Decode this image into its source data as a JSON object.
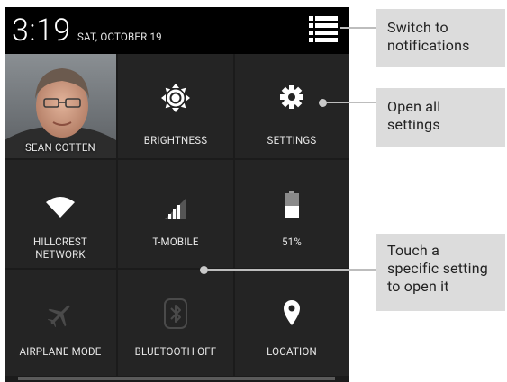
{
  "status_bar": {
    "time": "3:19",
    "date": "SAT, OCTOBER 19",
    "notifications_toggle_icon": "notifications-list-icon"
  },
  "quick_settings": {
    "tiles": [
      {
        "label": "SEAN COTTEN",
        "icon": "user-avatar-photo"
      },
      {
        "label": "BRIGHTNESS",
        "icon": "brightness-icon"
      },
      {
        "label": "SETTINGS",
        "icon": "gear-icon"
      },
      {
        "label": "HILLCREST\nNETWORK",
        "line1": "HILLCREST",
        "line2": "NETWORK",
        "icon": "wifi-icon"
      },
      {
        "label": "T-MOBILE",
        "icon": "cell-signal-icon"
      },
      {
        "label": "51%",
        "icon": "battery-icon",
        "battery_level": 0.51
      },
      {
        "label": "AIRPLANE MODE",
        "icon": "airplane-icon"
      },
      {
        "label": "BLUETOOTH OFF",
        "icon": "bluetooth-icon"
      },
      {
        "label": "LOCATION",
        "icon": "location-pin-icon"
      }
    ]
  },
  "callouts": [
    {
      "line1": "Switch to",
      "line2": "notifications"
    },
    {
      "line1": "Open all",
      "line2": "settings"
    },
    {
      "line1": "Touch a",
      "line2": "specific setting",
      "line3": "to open it"
    }
  ],
  "colors": {
    "panel_background": "#1b1b1b",
    "tile_background": "#242424",
    "status_bar_background": "#000000",
    "callout_background": "#dcdcdc",
    "connector_color": "#bdbdbd"
  }
}
